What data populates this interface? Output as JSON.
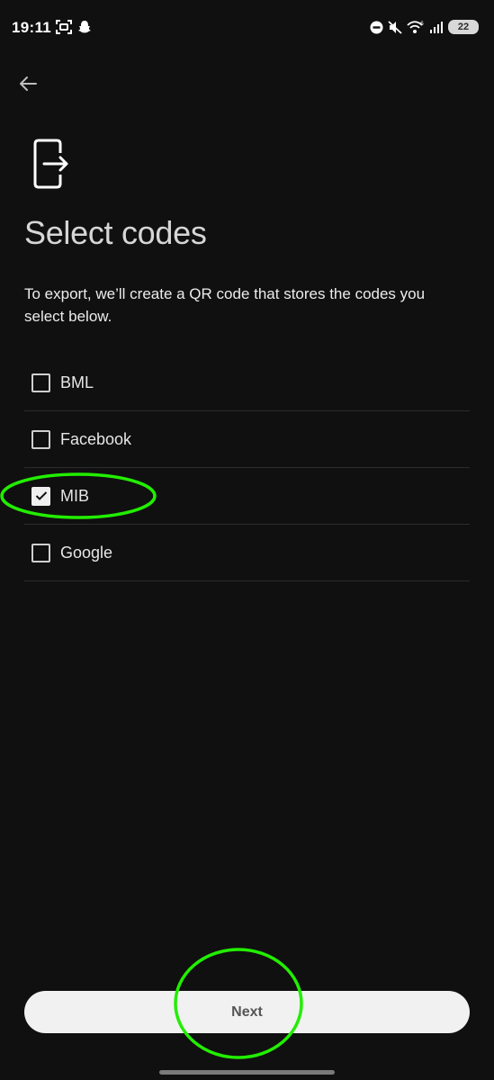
{
  "status_bar": {
    "time": "19:11",
    "battery": "22",
    "left_icons": [
      "screen-record-icon",
      "snapchat-icon"
    ],
    "right_icons": [
      "do-not-disturb-icon",
      "mute-icon",
      "wifi-icon",
      "signal-icon",
      "battery-icon"
    ]
  },
  "header": {
    "back_icon": "arrow-left-icon",
    "export_icon": "phone-export-icon"
  },
  "main": {
    "title": "Select codes",
    "description": "To export, we’ll create a QR code that stores the codes you select below.",
    "codes": [
      {
        "label": "BML",
        "checked": false
      },
      {
        "label": "Facebook",
        "checked": false
      },
      {
        "label": "MIB",
        "checked": true
      },
      {
        "label": "Google",
        "checked": false
      }
    ]
  },
  "footer": {
    "next_label": "Next"
  },
  "annotations": {
    "highlight_color": "#22ee00"
  }
}
